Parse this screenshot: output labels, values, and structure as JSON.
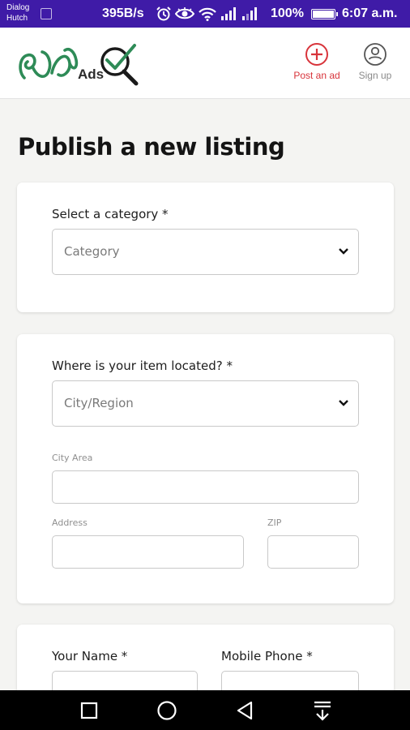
{
  "status_bar": {
    "carrier_line1": "Dialog",
    "carrier_line2": "Hutch",
    "net_speed": "395B/s",
    "battery": "100%",
    "time": "6:07 a.m."
  },
  "header": {
    "logo_text": "Ads",
    "post_ad_label": "Post an ad",
    "sign_up_label": "Sign up",
    "accent_color": "#d8343b",
    "logo_color": "#2e8b57"
  },
  "page_title": "Publish a new listing",
  "category_section": {
    "label": "Select a category *",
    "select_placeholder": "Category"
  },
  "location_section": {
    "label": "Where is your item located? *",
    "select_placeholder": "City/Region",
    "city_area_label": "City Area",
    "address_label": "Address",
    "zip_label": "ZIP"
  },
  "contact_section": {
    "name_label": "Your Name *",
    "phone_label": "Mobile Phone *"
  }
}
